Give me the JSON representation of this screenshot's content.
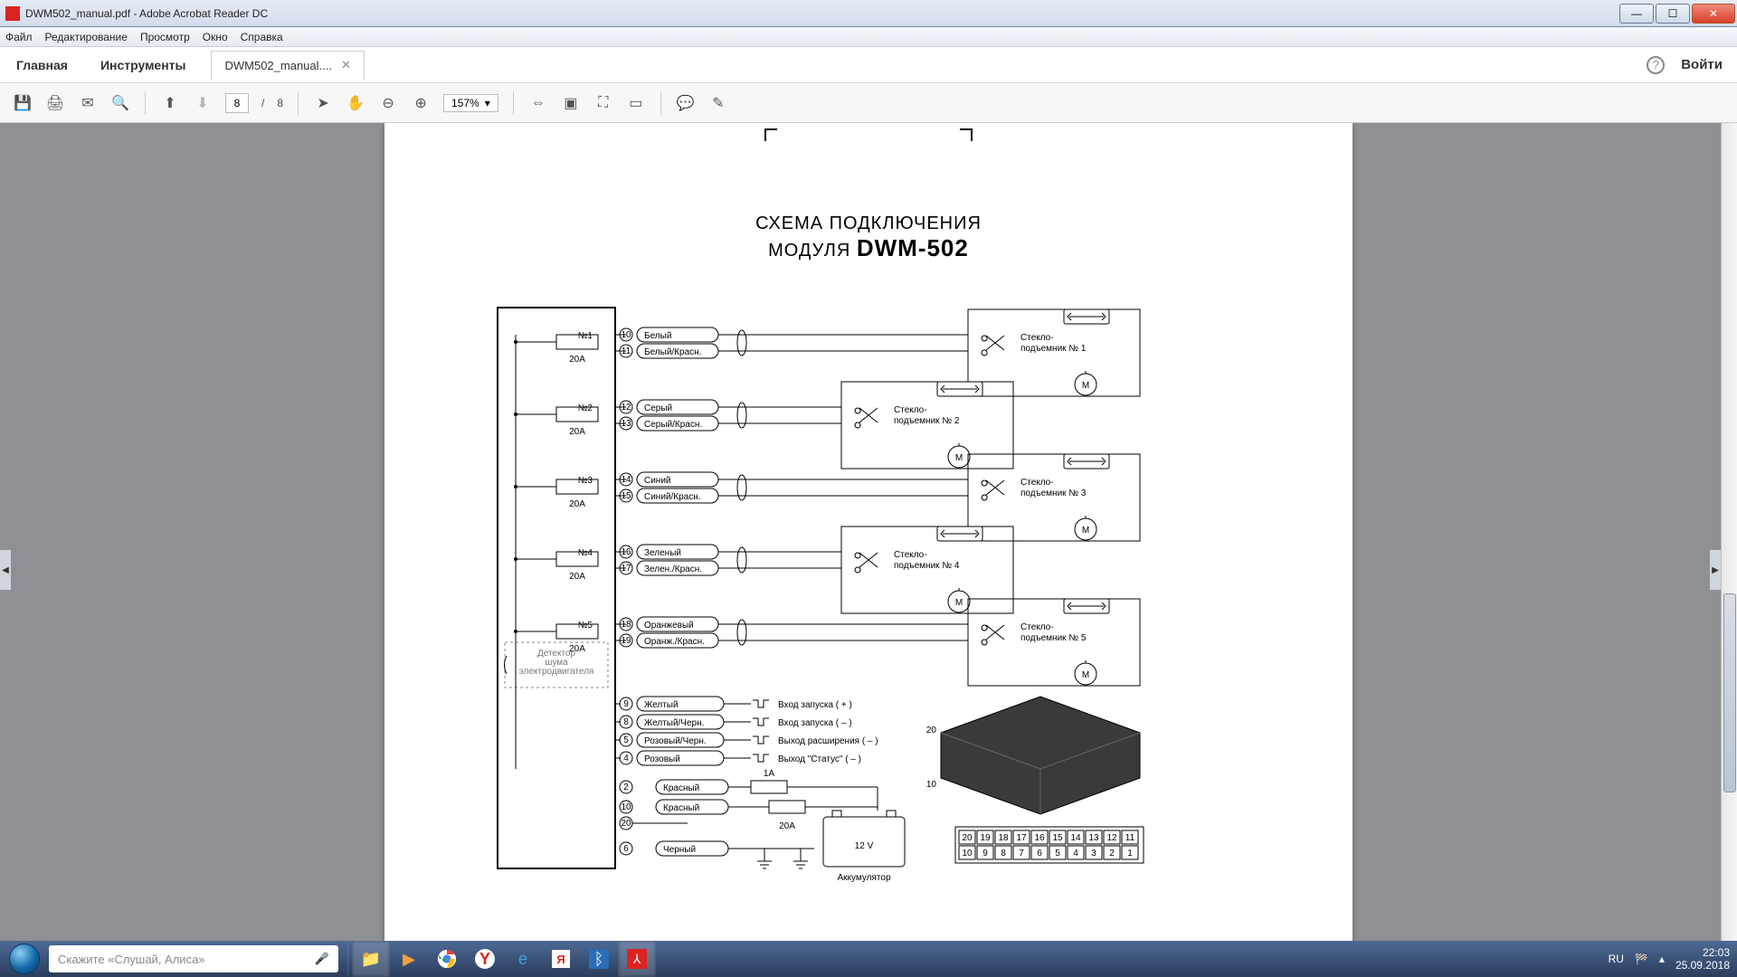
{
  "window": {
    "title": "DWM502_manual.pdf - Adobe Acrobat Reader DC"
  },
  "menu": {
    "file": "Файл",
    "edit": "Редактирование",
    "view": "Просмотр",
    "window": "Окно",
    "help": "Справка"
  },
  "nav": {
    "home": "Главная",
    "tools": "Инструменты",
    "doc_tab": "DWM502_manual....",
    "login": "Войти"
  },
  "toolbar": {
    "page": "8",
    "page_sep": "/",
    "page_total": "8",
    "zoom": "157%"
  },
  "diagram": {
    "title_l1": "СХЕМА ПОДКЛЮЧЕНИЯ",
    "title_l2a": "МОДУЛЯ ",
    "title_l2b": "DWM-502",
    "detector_l1": "Детектор",
    "detector_l2": "шума",
    "detector_l3": "электродвигателя",
    "channels": [
      {
        "num": "№1",
        "fuse": "20A",
        "pin1": "10",
        "pin2": "11",
        "wire1": "Белый",
        "wire2": "Белый/Красн.",
        "outL1": "Стекло-",
        "outL2": "подъемник № 1",
        "motor": "M"
      },
      {
        "num": "№2",
        "fuse": "20A",
        "pin1": "12",
        "pin2": "13",
        "wire1": "Серый",
        "wire2": "Серый/Красн.",
        "outL1": "Стекло-",
        "outL2": "подъемник № 2",
        "motor": "M"
      },
      {
        "num": "№3",
        "fuse": "20A",
        "pin1": "14",
        "pin2": "15",
        "wire1": "Синий",
        "wire2": "Синий/Красн.",
        "outL1": "Стекло-",
        "outL2": "подъемник № 3",
        "motor": "M"
      },
      {
        "num": "№4",
        "fuse": "20A",
        "pin1": "16",
        "pin2": "17",
        "wire1": "Зеленый",
        "wire2": "Зелен./Красн.",
        "outL1": "Стекло-",
        "outL2": "подъемник № 4",
        "motor": "M"
      },
      {
        "num": "№5",
        "fuse": "20A",
        "pin1": "18",
        "pin2": "19",
        "wire1": "Оранжевый",
        "wire2": "Оранж./Красн.",
        "outL1": "Стекло-",
        "outL2": "подъемник № 5",
        "motor": "M"
      }
    ],
    "signals": [
      {
        "pin": "9",
        "wire": "Желтый",
        "label": "Вход запуска ( + )"
      },
      {
        "pin": "8",
        "wire": "Желтый/Черн.",
        "label": "Вход запуска ( – )"
      },
      {
        "pin": "5",
        "wire": "Розовый/Черн.",
        "label": "Выход расширения ( – )"
      },
      {
        "pin": "4",
        "wire": "Розовый",
        "label": "Выход \"Статус\" ( – )"
      }
    ],
    "power": {
      "fuse_top": "1A",
      "fuse_bot": "20A",
      "red_pin1": "2",
      "red_pin2": "10",
      "pin20": "20",
      "gnd_pin": "6",
      "red": "Красный",
      "black": "Черный",
      "volt": "12 V",
      "batt": "Аккумулятор"
    },
    "conn": {
      "top": [
        "20",
        "19",
        "18",
        "17",
        "16",
        "15",
        "14",
        "13",
        "12",
        "11"
      ],
      "bot": [
        "10",
        "9",
        "8",
        "7",
        "6",
        "5",
        "4",
        "3",
        "2",
        "1"
      ],
      "side20": "20",
      "side10": "10"
    }
  },
  "taskbar": {
    "search_ph": "Скажите «Слушай, Алиса»",
    "lang": "RU",
    "time": "22:03",
    "date": "25.09.2018"
  }
}
